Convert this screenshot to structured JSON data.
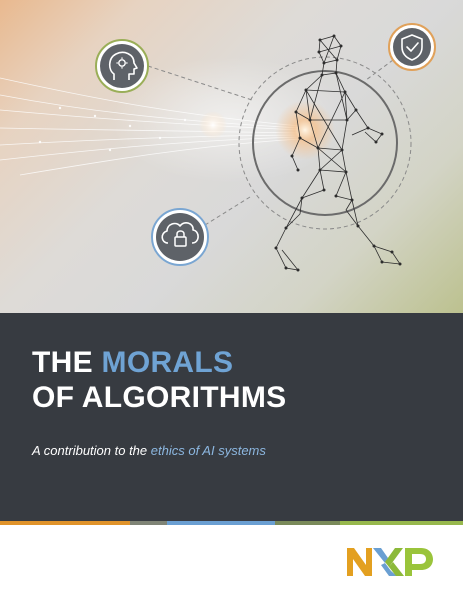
{
  "cover": {
    "title_prefix": "THE ",
    "title_accent": "MORALS",
    "title_line2": "OF ALGORITHMS",
    "subtitle_prefix": "A contribution to the ",
    "subtitle_accent": "ethics of AI systems"
  },
  "brand": {
    "logo_letters": [
      "N",
      "X",
      "P"
    ],
    "colors": {
      "N": "#e3a020",
      "X_left": "#6a9fd2",
      "X_right": "#8cb93a",
      "P": "#9ac43b"
    }
  },
  "icons": {
    "top_left": "head-gear-icon",
    "top_right": "shield-check-icon",
    "bottom_left": "cloud-lock-icon"
  },
  "colors": {
    "band": "#373b41",
    "accent_blue": "#6fa3d4",
    "stripes": [
      "#e0932a",
      "#7f8476",
      "#6a9fd2",
      "#7a8a5a",
      "#97b84d"
    ]
  }
}
